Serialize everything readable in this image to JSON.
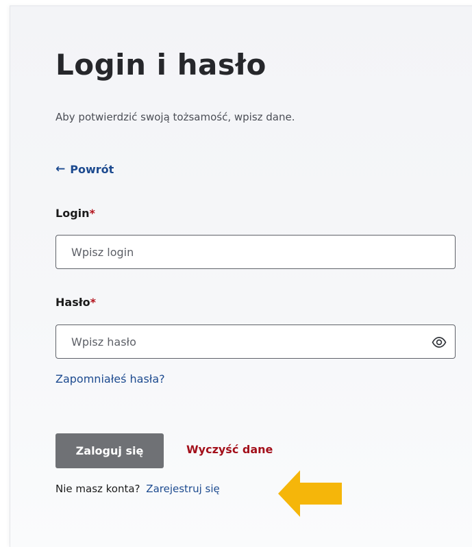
{
  "page": {
    "title": "Login i hasło",
    "subtitle": "Aby potwierdzić swoją tożsamość, wpisz dane."
  },
  "back": {
    "arrow": "←",
    "label": "Powrót"
  },
  "login_field": {
    "label": "Login",
    "required_mark": "*",
    "placeholder": "Wpisz login",
    "value": ""
  },
  "password_field": {
    "label": "Hasło",
    "required_mark": "*",
    "placeholder": "Wpisz hasło",
    "value": "",
    "toggle_icon": "eye-icon"
  },
  "forgot_password": {
    "label": "Zapomniałeś hasła?"
  },
  "actions": {
    "login_label": "Zaloguj się",
    "clear_label": "Wyczyść dane"
  },
  "register": {
    "prompt": "Nie masz konta?",
    "link_label": "Zarejestruj się"
  },
  "annotation": {
    "icon": "pointer-arrow-icon",
    "color": "#f5b60a"
  },
  "colors": {
    "link": "#1c4a8f",
    "required": "#b3121c",
    "danger": "#a3101b",
    "primary_button": "#6f7175",
    "card_background": "#f3f4f7"
  }
}
